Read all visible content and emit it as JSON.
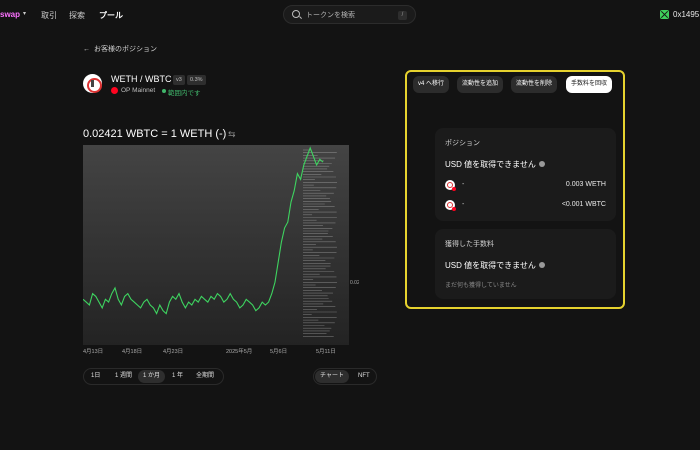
{
  "nav": {
    "brand": "swap",
    "caret": "▾",
    "links": [
      "取引",
      "探索",
      "プール"
    ],
    "search_placeholder": "トークンを検索",
    "search_key": "/",
    "wallet": "0x1495..."
  },
  "back_label": "お客様のポジション",
  "pool": {
    "pair": "WETH / WBTC",
    "version": "v3",
    "fee": "0.3%",
    "network": "OP Mainnet",
    "status": "範囲内です"
  },
  "price": {
    "text": "0.02421 WBTC = 1 WETH",
    "suffix": "(-)",
    "swap_glyph": "⇆"
  },
  "actions": {
    "migrate": "v4 へ移行",
    "add": "流動性を追加",
    "remove": "流動性を削除",
    "collect": "手数料を回収"
  },
  "position_card": {
    "title": "ポジション",
    "usd": "USD 値を取得できません",
    "tokens": [
      {
        "label": "-",
        "amount": "0.003 WETH"
      },
      {
        "label": "-",
        "amount": "<0.001 WBTC"
      }
    ]
  },
  "fees_card": {
    "title": "獲得した手数料",
    "usd": "USD 値を取得できません",
    "note": "まだ何も獲得していません"
  },
  "chart_controls": {
    "ranges": [
      "1日",
      "1 週間",
      "1 か月",
      "1 年",
      "全期間"
    ],
    "active_range": 2,
    "toggles": [
      "チャート",
      "NFT"
    ],
    "active_toggle": 0
  },
  "chart_data": {
    "type": "line",
    "title": "",
    "xlabel": "",
    "ylabel": "",
    "x_ticks": [
      "4月13日",
      "4月18日",
      "4月23日",
      "2025年5月",
      "5月6日",
      "5月11日"
    ],
    "y_marker": "0.02",
    "ylim": [
      0.0178,
      0.0248
    ],
    "grid": false,
    "series": [
      {
        "values": [
          0.0194,
          0.0193,
          0.0192,
          0.0196,
          0.0195,
          0.0193,
          0.0191,
          0.0194,
          0.0193,
          0.0196,
          0.0198,
          0.0194,
          0.0192,
          0.0195,
          0.0196,
          0.0194,
          0.0193,
          0.0192,
          0.0191,
          0.0193,
          0.0194,
          0.0192,
          0.0191,
          0.0189,
          0.0192,
          0.019,
          0.0189,
          0.0193,
          0.0195,
          0.0194,
          0.0196,
          0.0193,
          0.0191,
          0.0193,
          0.0192,
          0.0194,
          0.0193,
          0.0195,
          0.0194,
          0.0193,
          0.0195,
          0.0194,
          0.0196,
          0.0195,
          0.0193,
          0.0194,
          0.0196,
          0.0194,
          0.0193,
          0.0191,
          0.0192,
          0.0194,
          0.0193,
          0.0192,
          0.019,
          0.0191,
          0.0193,
          0.0192,
          0.0193,
          0.0196,
          0.02,
          0.0207,
          0.0214,
          0.0219,
          0.0221,
          0.0228,
          0.0232,
          0.0238,
          0.0236,
          0.0241,
          0.0244,
          0.0247,
          0.0244,
          0.0241,
          0.0243,
          0.0242
        ]
      }
    ]
  }
}
